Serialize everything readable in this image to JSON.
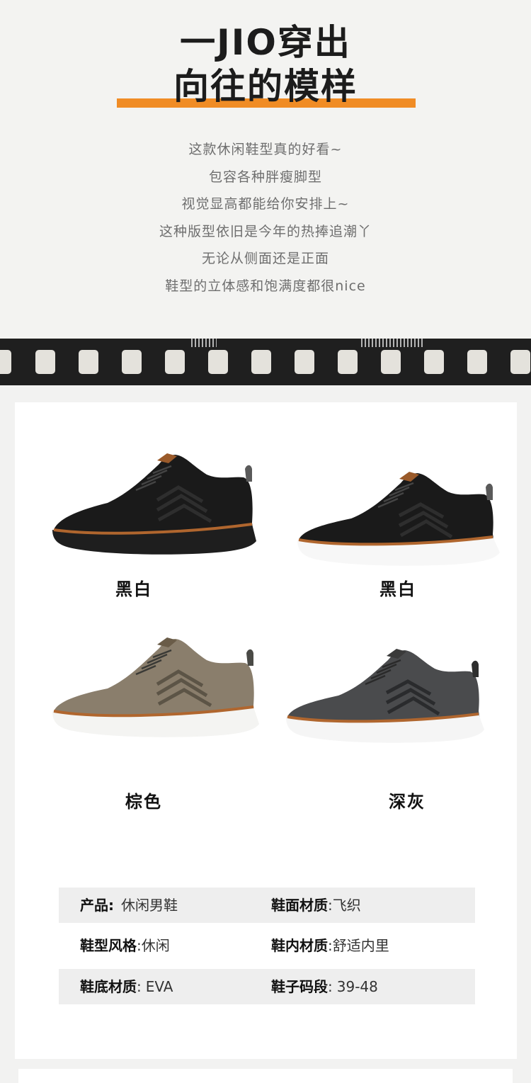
{
  "hero": {
    "title_line1": "一JIO穿出",
    "title_line2": "向往的模样",
    "description": [
      "这款休闲鞋型真的好看~",
      "包容各种胖瘦脚型",
      "视觉显高都能给你安排上~",
      "这种版型依旧是今年的热捧追潮丫",
      "无论从侧面还是正面",
      "鞋型的立体感和饱满度都很nice"
    ],
    "accent_color": "#f08c25"
  },
  "variants": [
    {
      "label": "黑白",
      "upper_color": "#1a1a1a",
      "sole_color": "#1e1e1e"
    },
    {
      "label": "黑白",
      "upper_color": "#1a1a1a",
      "sole_color": "#f7f7f7"
    },
    {
      "label": "棕色",
      "upper_color": "#8a7e6c",
      "sole_color": "#f4f4f2"
    },
    {
      "label": "深灰",
      "upper_color": "#4a4b4d",
      "sole_color": "#f5f5f5"
    }
  ],
  "specs": [
    {
      "label1": "产品",
      "sep1": ":",
      "value1": "休闲男鞋",
      "label2": "鞋面材质",
      "sep2": ":",
      "value2": "飞织"
    },
    {
      "label1": "鞋型风格",
      "sep1": ":",
      "value1": "休闲",
      "label2": "鞋内材质",
      "sep2": ":",
      "value2": "舒适内里"
    },
    {
      "label1": "鞋底材质",
      "sep1": ":",
      "value1": "EVA",
      "label2": "鞋子码段",
      "sep2": ":",
      "value2": "39-48"
    }
  ]
}
